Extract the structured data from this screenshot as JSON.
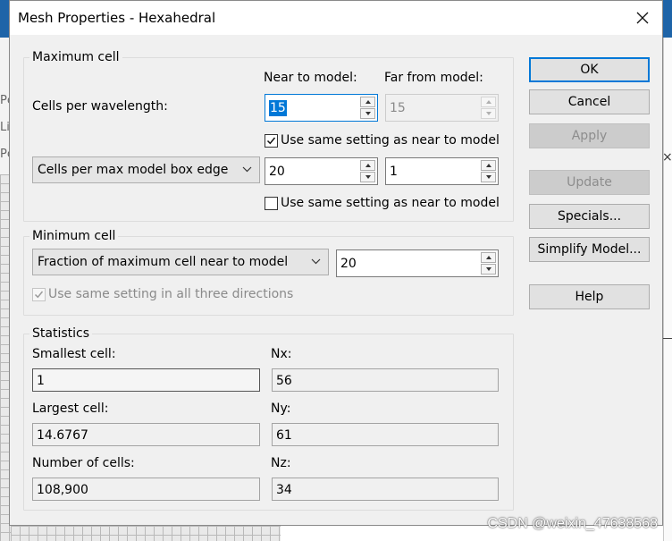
{
  "dialog": {
    "title": "Mesh Properties - Hexahedral",
    "close_glyph": "close-icon"
  },
  "maximum_cell": {
    "group_title": "Maximum cell",
    "near_header": "Near to model:",
    "far_header": "Far from model:",
    "cells_per_wavelength_label": "Cells per wavelength:",
    "wavelength_near_value": "15",
    "wavelength_far_value": "15",
    "same_setting_1_label": "Use same setting as near to model",
    "same_setting_1_checked": true,
    "edge_mode_selected": "Cells per max model box edge",
    "edge_near_value": "20",
    "edge_far_value": "1",
    "same_setting_2_label": "Use same setting as near to model",
    "same_setting_2_checked": false
  },
  "minimum_cell": {
    "group_title": "Minimum cell",
    "mode_selected": "Fraction of maximum cell near to model",
    "value": "20",
    "three_directions_label": "Use same setting in all three directions",
    "three_directions_checked": true
  },
  "statistics": {
    "group_title": "Statistics",
    "smallest_cell_label": "Smallest cell:",
    "smallest_cell_value": "1",
    "largest_cell_label": "Largest cell:",
    "largest_cell_value": "14.6767",
    "number_of_cells_label": "Number of cells:",
    "number_of_cells_value": "108,900",
    "nx_label": "Nx:",
    "nx_value": "56",
    "ny_label": "Ny:",
    "ny_value": "61",
    "nz_label": "Nz:",
    "nz_value": "34"
  },
  "buttons": {
    "ok": "OK",
    "cancel": "Cancel",
    "apply": "Apply",
    "update": "Update",
    "specials": "Specials...",
    "simplify_model": "Simplify Model...",
    "help": "Help"
  },
  "background": {
    "side_fragments": [
      "Pc",
      "Li",
      "Pc"
    ]
  },
  "watermark": "CSDN @weixin_47638568",
  "colors": {
    "accent": "#0078d7",
    "app_ribbon": "#1e64a8",
    "dialog_bg": "#f0f0f0"
  }
}
